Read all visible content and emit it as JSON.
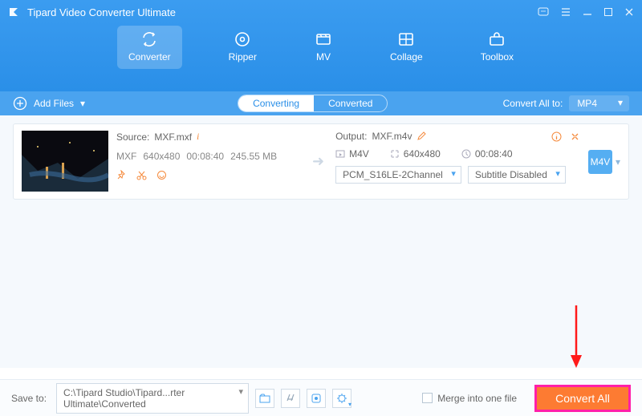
{
  "app": {
    "title": "Tipard Video Converter Ultimate"
  },
  "nav": {
    "tabs": [
      {
        "id": "converter",
        "label": "Converter"
      },
      {
        "id": "ripper",
        "label": "Ripper"
      },
      {
        "id": "mv",
        "label": "MV"
      },
      {
        "id": "collage",
        "label": "Collage"
      },
      {
        "id": "toolbox",
        "label": "Toolbox"
      }
    ],
    "active": "converter"
  },
  "toolbar": {
    "add_files": "Add Files",
    "seg": {
      "converting": "Converting",
      "converted": "Converted",
      "active": "converting"
    },
    "convert_all_to_label": "Convert All to:",
    "convert_all_to_value": "MP4"
  },
  "item": {
    "source_label": "Source:",
    "source_name": "MXF.mxf",
    "src": {
      "fmt": "MXF",
      "res": "640x480",
      "dur": "00:08:40",
      "size": "245.55 MB"
    },
    "output_label": "Output:",
    "output_name": "MXF.m4v",
    "out": {
      "fmt": "M4V",
      "res": "640x480",
      "dur": "00:08:40"
    },
    "audio_sel": "PCM_S16LE-2Channel",
    "sub_sel": "Subtitle Disabled",
    "fmt_badge": "M4V"
  },
  "footer": {
    "save_to_label": "Save to:",
    "save_path": "C:\\Tipard Studio\\Tipard...rter Ultimate\\Converted",
    "merge_label": "Merge into one file",
    "convert_all": "Convert All"
  }
}
